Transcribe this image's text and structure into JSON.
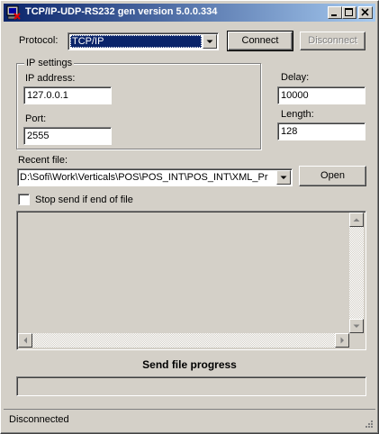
{
  "window": {
    "title": "TCP/IP-UDP-RS232 gen version 5.0.0.334"
  },
  "protocol": {
    "label": "Protocol:",
    "selected": "TCP/IP",
    "connect_label": "Connect",
    "disconnect_label": "Disconnect"
  },
  "ip_settings": {
    "group_label": "IP settings",
    "ip_label": "IP address:",
    "ip_value": "127.0.0.1",
    "port_label": "Port:",
    "port_value": "2555"
  },
  "delay": {
    "label": "Delay:",
    "value": "10000"
  },
  "length": {
    "label": "Length:",
    "value": "128"
  },
  "recent_file": {
    "label": "Recent file:",
    "value": "D:\\Sofi\\Work\\Verticals\\POS\\POS_INT\\POS_INT\\XML_Pr",
    "open_label": "Open"
  },
  "stop_send": {
    "label": "Stop send if end of file",
    "checked": false
  },
  "progress": {
    "label": "Send file progress",
    "value": 0
  },
  "status": {
    "text": "Disconnected"
  },
  "colors": {
    "title_start": "#0a246a",
    "title_end": "#a6caf0",
    "selection": "#0a246a",
    "face": "#d4d0c8"
  },
  "icons": [
    "app-icon",
    "minimize-icon",
    "maximize-icon",
    "close-icon",
    "dropdown-arrow-icon",
    "scroll-up-icon",
    "scroll-down-icon",
    "scroll-left-icon",
    "scroll-right-icon",
    "size-grip-icon"
  ]
}
